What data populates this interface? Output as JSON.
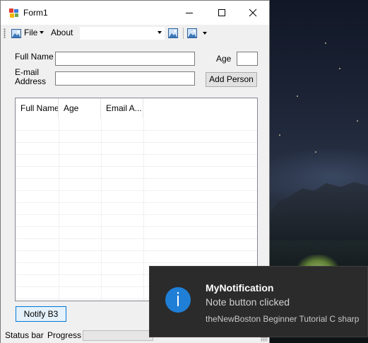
{
  "window": {
    "title": "Form1"
  },
  "toolbar": {
    "file_label": "File",
    "about_label": "About",
    "combo_value": ""
  },
  "form": {
    "full_name_label": "Full Name",
    "full_name_value": "",
    "age_label": "Age",
    "age_value": "",
    "email_label_line1": "E-mail",
    "email_label_line2": "Address",
    "email_value": "",
    "add_person_label": "Add Person"
  },
  "listview": {
    "columns": [
      "Full Name",
      "Age",
      "Email A..."
    ],
    "rows": []
  },
  "notify_button_label": "Notify B3",
  "status": {
    "status_label": "Status bar",
    "progress_label": "Progress",
    "progress_fraction": 0
  },
  "toast": {
    "title": "MyNotification",
    "message": "Note button clicked",
    "source": "theNewBoston Beginner Tutorial C sharp",
    "icon": "info-icon"
  },
  "colors": {
    "accent": "#0078d7",
    "toast_bg": "#2b2b2b",
    "info_icon": "#1f7fd6"
  }
}
